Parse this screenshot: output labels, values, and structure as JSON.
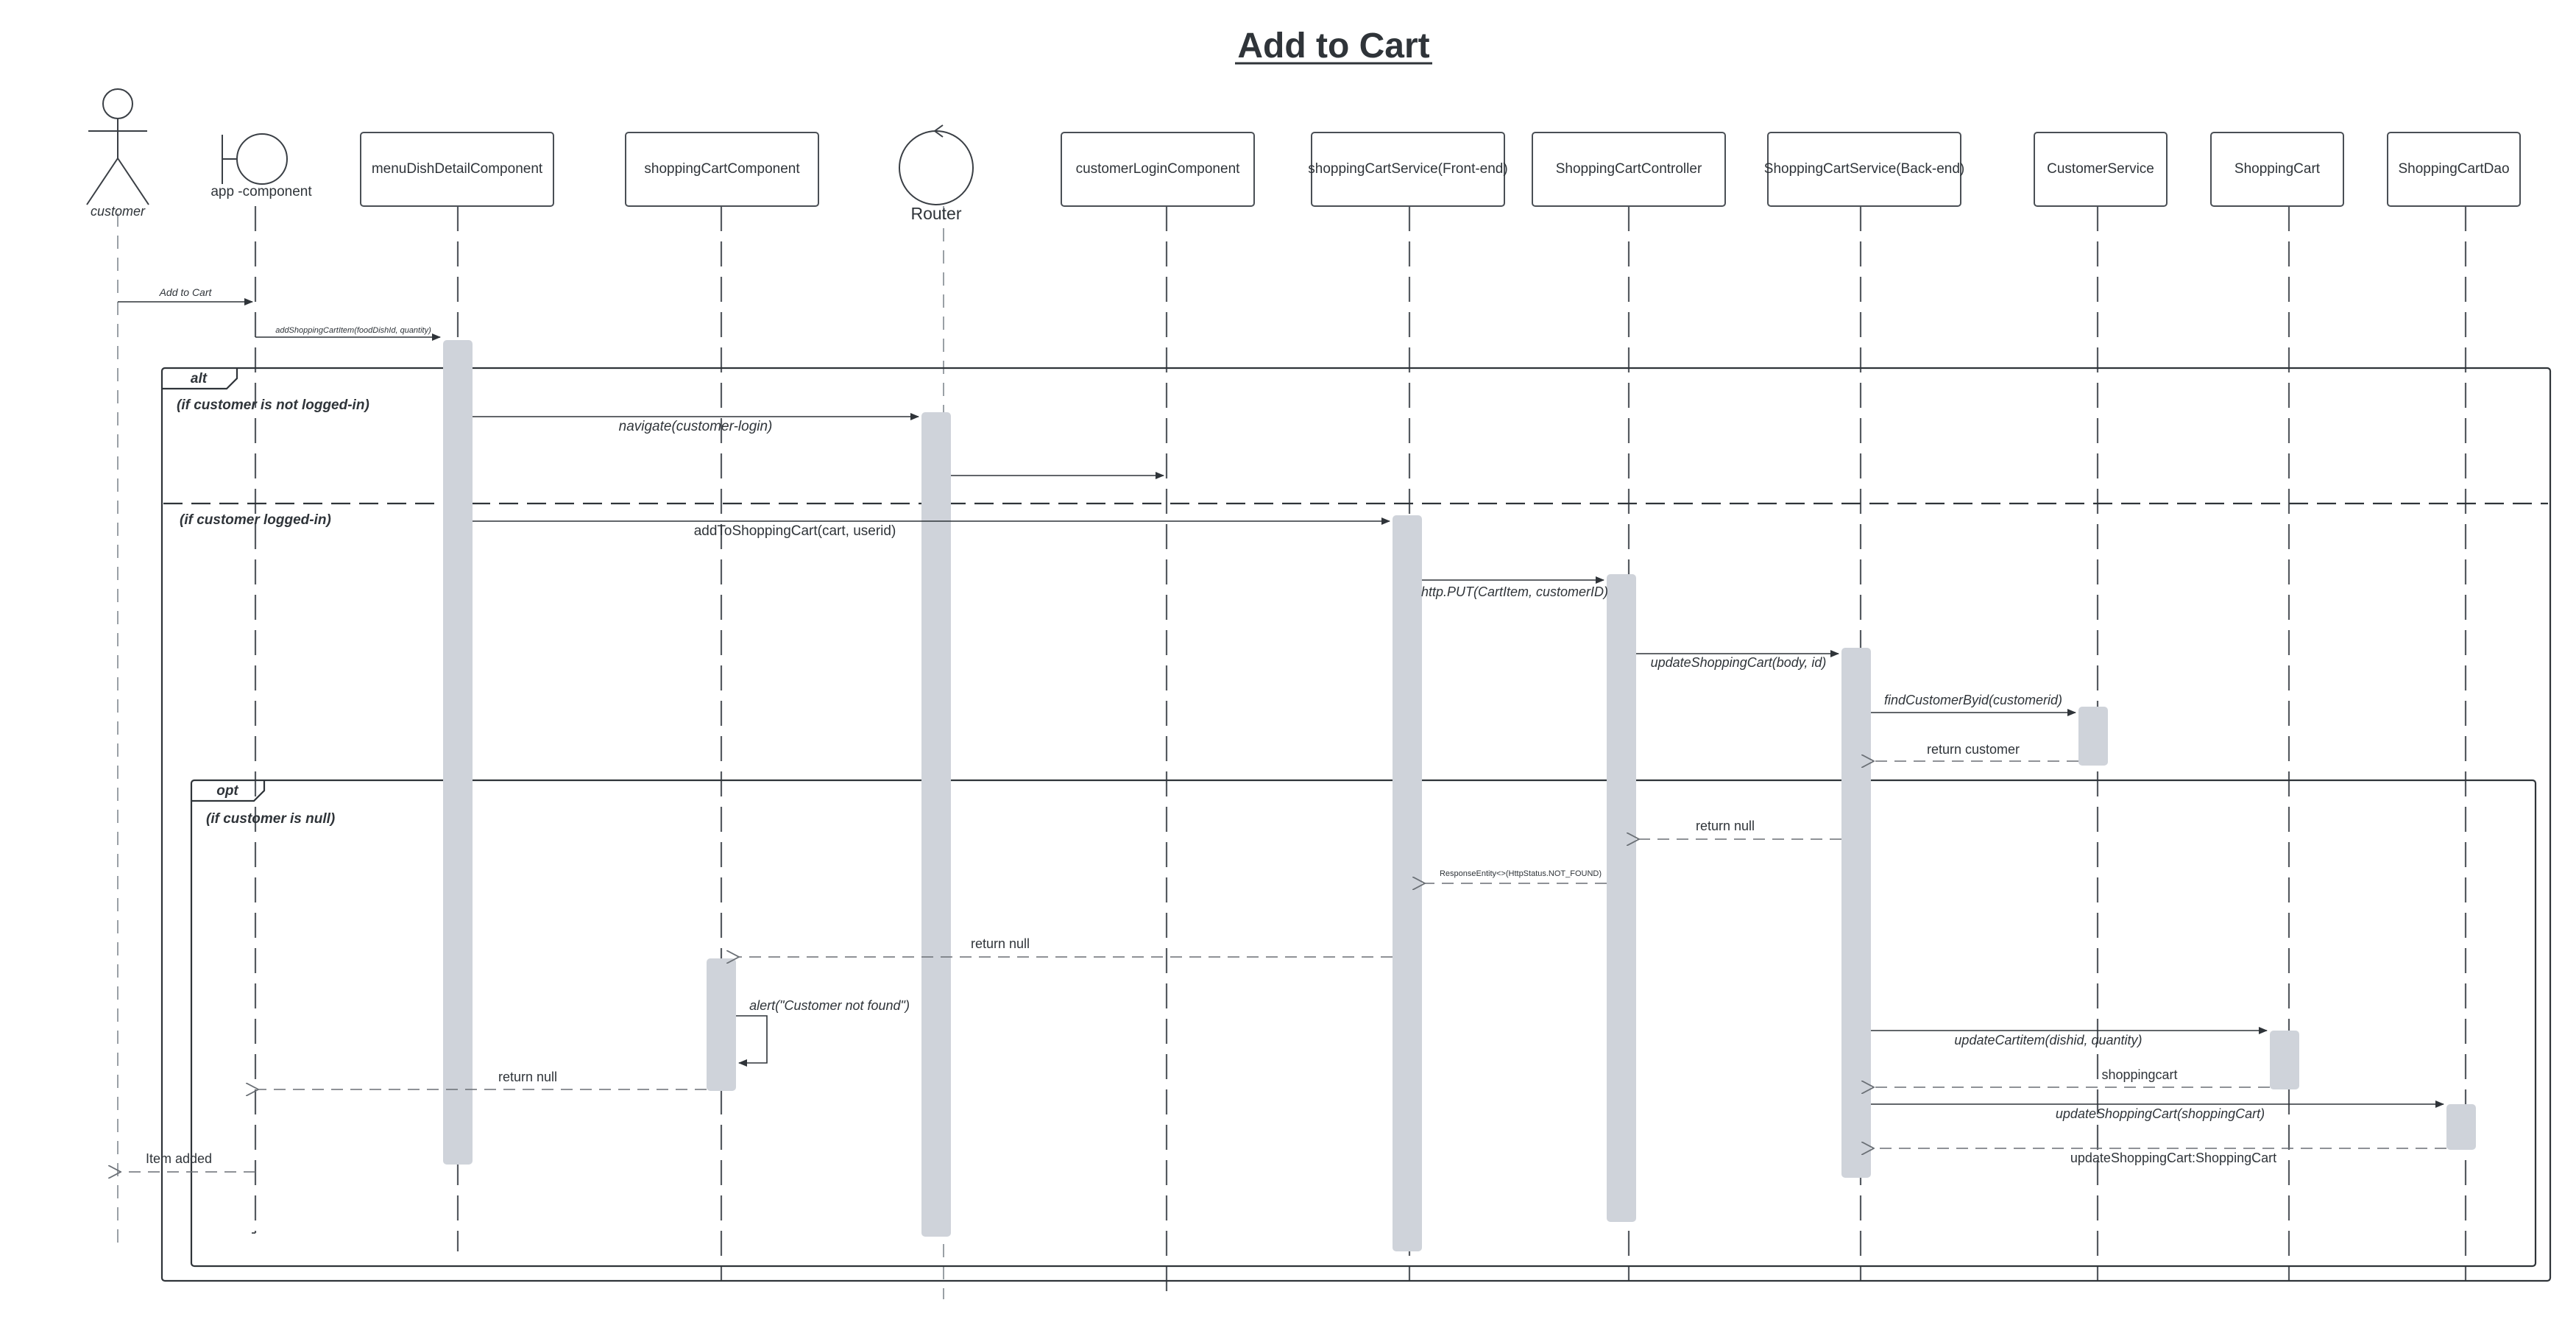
{
  "title": "Add to Cart",
  "participants": [
    {
      "id": "customer",
      "label": "customer",
      "kind": "actor"
    },
    {
      "id": "app",
      "label": "app -component",
      "kind": "boundary"
    },
    {
      "id": "menu",
      "label": "menuDishDetailComponent",
      "kind": "box"
    },
    {
      "id": "cartcomp",
      "label": "shoppingCartComponent",
      "kind": "box"
    },
    {
      "id": "router",
      "label": "Router",
      "kind": "control"
    },
    {
      "id": "login",
      "label": "customerLoginComponent",
      "kind": "box"
    },
    {
      "id": "cartfe",
      "label": "shoppingCartService(Front-end)",
      "kind": "box"
    },
    {
      "id": "ctrl",
      "label": "ShoppingCartController",
      "kind": "box"
    },
    {
      "id": "cartbe",
      "label": "ShoppingCartService(Back-end)",
      "kind": "box"
    },
    {
      "id": "custsvc",
      "label": "CustomerService",
      "kind": "box"
    },
    {
      "id": "cart",
      "label": "ShoppingCart",
      "kind": "box"
    },
    {
      "id": "dao",
      "label": "ShoppingCartDao",
      "kind": "box"
    }
  ],
  "fragments": {
    "alt": {
      "label": "alt",
      "guard1": "(if customer is not logged-in)",
      "guard2": "(if customer logged-in)"
    },
    "opt": {
      "label": "opt",
      "guard": "(if customer is null)"
    }
  },
  "messages": [
    {
      "label": "Add to Cart"
    },
    {
      "label": "addShoppingCartItem(foodDishId, quantity)"
    },
    {
      "label": "navigate(customer-login)"
    },
    {
      "label": ""
    },
    {
      "label": "addToShoppingCart(cart, userid)"
    },
    {
      "label": "http.PUT(CartItem, customerID)"
    },
    {
      "label": "updateShoppingCart(body, id)"
    },
    {
      "label": "findCustomerByid(customerid)"
    },
    {
      "label": "return customer"
    },
    {
      "label": "return null"
    },
    {
      "label": "ResponseEntity<>(HttpStatus.NOT_FOUND)"
    },
    {
      "label": "return null"
    },
    {
      "label": "alert(\"Customer not found\")"
    },
    {
      "label": "return null"
    },
    {
      "label": "updateCartitem(dishid, quantity)"
    },
    {
      "label": "shoppingcart"
    },
    {
      "label": "updateShoppingCart(shoppingCart)"
    },
    {
      "label": "updateShoppingCart:ShoppingCart"
    },
    {
      "label": "Item added"
    }
  ]
}
